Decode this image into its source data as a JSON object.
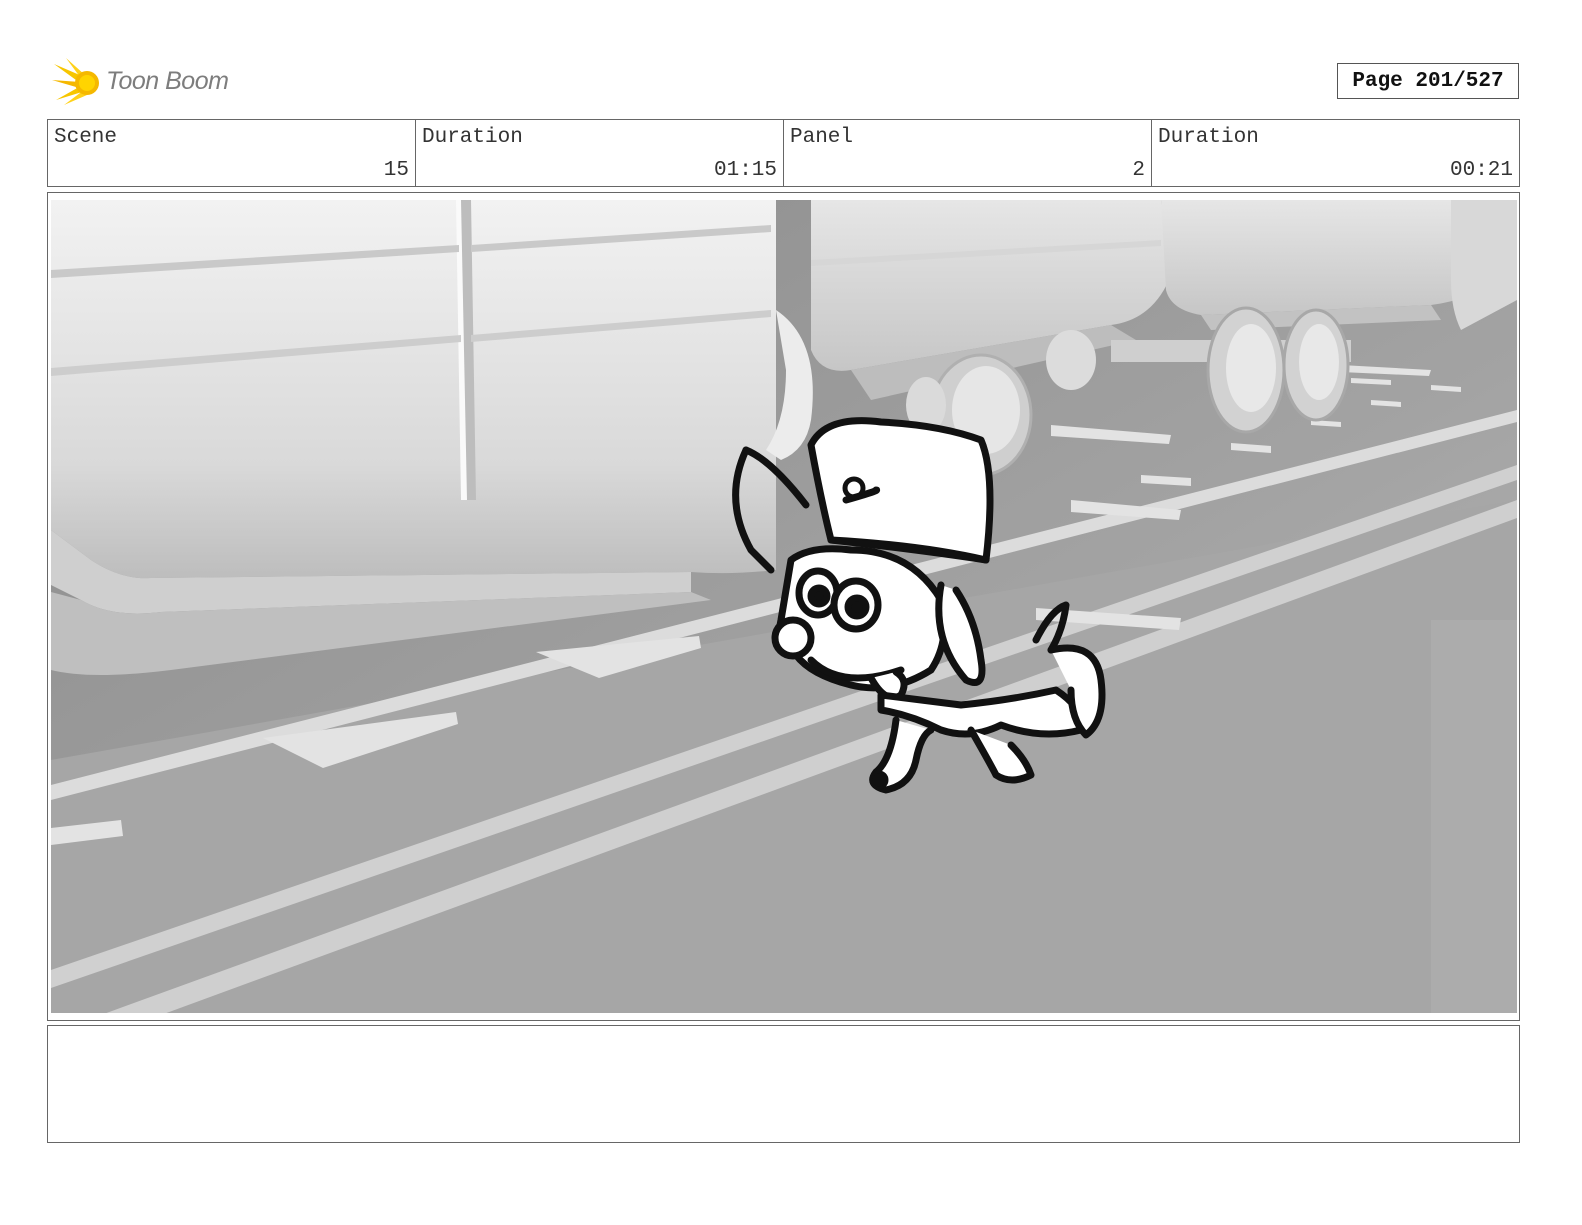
{
  "header": {
    "logo_text": "Toon Boom",
    "logo_icon": "toon-boom-burst-icon",
    "page_label": "Page 201/527",
    "accent_color": "#f5c400"
  },
  "info": {
    "scene_label": "Scene",
    "scene_value": "15",
    "scene_duration_label": "Duration",
    "scene_duration_value": "01:15",
    "panel_label": "Panel",
    "panel_value": "2",
    "panel_duration_label": "Duration",
    "panel_duration_value": "00:21"
  },
  "caption": {
    "text": ""
  }
}
